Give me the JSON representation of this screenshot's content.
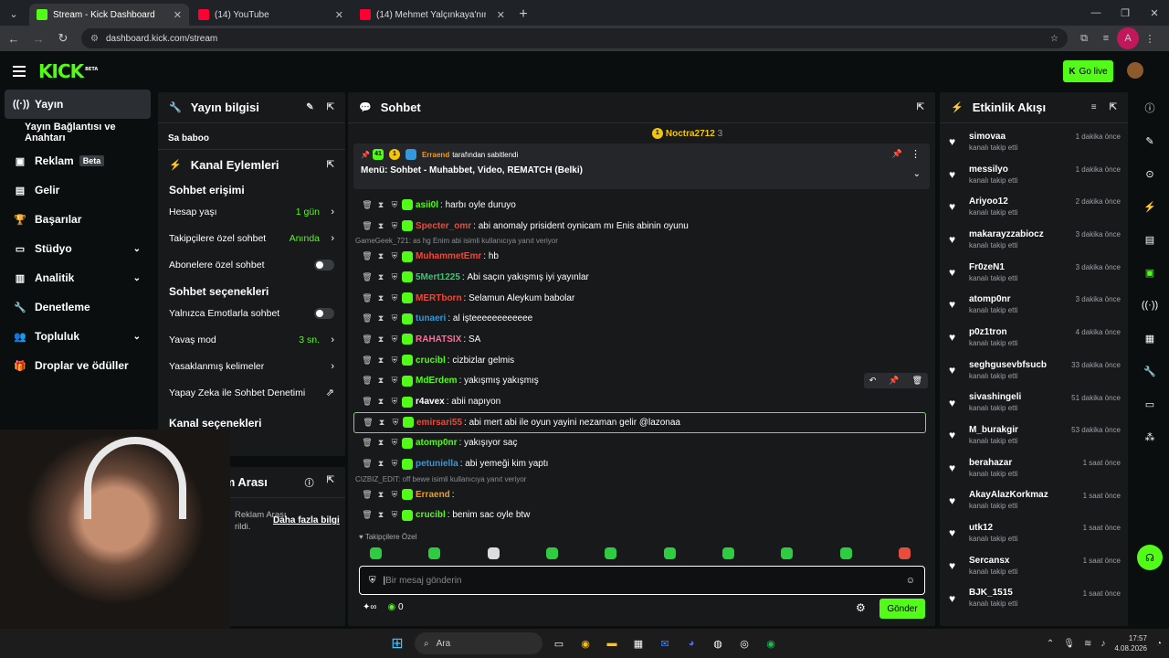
{
  "browser": {
    "tabs": [
      {
        "title": "Stream - Kick Dashboard",
        "fav_color": "#53fc18",
        "active": true
      },
      {
        "title": "(14) YouTube",
        "fav_color": "#ff0033",
        "active": false
      },
      {
        "title": "(14) Mehmet Yalçınkaya'nın Mu",
        "fav_color": "#ff0033",
        "active": false
      }
    ],
    "url": "dashboard.kick.com/stream",
    "profile_initial": "A"
  },
  "header": {
    "logo": "KICK",
    "logo_sup": "BETA",
    "go_live": "Go live"
  },
  "sidebar": {
    "items": [
      {
        "label": "Yayın",
        "icon": "broadcast-icon"
      },
      {
        "label": "Yayın Bağlantısı ve Anahtarı",
        "icon": ""
      },
      {
        "label": "Reklam",
        "icon": "ad-icon",
        "badge": "Beta"
      },
      {
        "label": "Gelir",
        "icon": "chart-icon"
      },
      {
        "label": "Başarılar",
        "icon": "trophy-icon"
      },
      {
        "label": "Stüdyo",
        "icon": "studio-icon"
      },
      {
        "label": "Analitik",
        "icon": "analytics-icon"
      },
      {
        "label": "Denetleme",
        "icon": "wrench-icon"
      },
      {
        "label": "Topluluk",
        "icon": "community-icon"
      },
      {
        "label": "Droplar ve ödüller",
        "icon": "gift-icon"
      }
    ]
  },
  "stream_info": {
    "title": "Yayın bilgisi",
    "stream_title": "Sa baboo"
  },
  "channel_actions": {
    "title": "Kanal Eylemleri",
    "chat_access": "Sohbet erişimi",
    "account_age": "Hesap yaşı",
    "account_age_val": "1 gün",
    "followers_only": "Takipçilere özel sohbet",
    "followers_only_val": "Anında",
    "subs_only": "Abonelere özel sohbet",
    "chat_options": "Sohbet seçenekleri",
    "emote_only": "Yalnızca Emotlarla sohbet",
    "slow_mode": "Yavaş mod",
    "slow_mode_val": "3 sn.",
    "banned_words": "Yasaklanmış kelimeler",
    "ai_moderation": "Yapay Zeka ile Sohbet Denetimi",
    "channel_options": "Kanal seçenekleri"
  },
  "ad_break": {
    "title": "Reklam Arası",
    "desc1": "Reklam Arası",
    "desc2": "rildi.",
    "more": "Daha fazla bilgi"
  },
  "chat": {
    "title": "Sohbet",
    "top_user": "Noctra2712",
    "top_count": "3",
    "pinned_by": "Erraend",
    "pinned_suffix": "tarafından sabitlendi",
    "pinned_msg": "Menü: Sohbet - Muhabbet, Video, REMATCH (Belki)",
    "messages": [
      {
        "user": "asii0l",
        "color": "#53fc18",
        "text": "harbı oyle duruyo"
      },
      {
        "user": "Specter_omr",
        "color": "#e74c3c",
        "text": "abi anomaly prisident oynicam mı Enis abinin oyunu"
      },
      {
        "reply": "GameGeek_721: as hg Enim abi isimli kullanıcıya yanıt veriyor"
      },
      {
        "user": "MuhammetEmr",
        "color": "#e74c3c",
        "text": "hb"
      },
      {
        "user": "5Mert1225",
        "color": "#2ecc71",
        "text": "Abi saçın yakışmış iyi yayınlar"
      },
      {
        "user": "MERTborn",
        "color": "#e74c3c",
        "text": "Selamun Aleykum babolar"
      },
      {
        "user": "tunaeri",
        "color": "#3498db",
        "text": "al işteeeeeeeeeeee"
      },
      {
        "user": "RAHATSIX",
        "color": "#ff6b9a",
        "text": "SA"
      },
      {
        "user": "crucibl",
        "color": "#53fc18",
        "text": "cizbizlar gelmis"
      },
      {
        "user": "MdErdem",
        "color": "#53fc18",
        "text": "yakışmış yakışmış"
      },
      {
        "user": "r4avex",
        "color": "#ffffff",
        "text": "abii napıyon"
      },
      {
        "user": "emirsari55",
        "color": "#e74c3c",
        "text": "abi mert abi ile oyun yayini nezaman gelir @lazonaa"
      },
      {
        "user": "atomp0nr",
        "color": "#53fc18",
        "text": "yakışıyor saç"
      },
      {
        "user": "petuniella",
        "color": "#3498db",
        "text": "abi yemeği kim yaptı"
      },
      {
        "reply": "CIZBIZ_EDIT: off bewe isimli kullanıcıya yanıt veriyor"
      },
      {
        "user": "Erraend",
        "color": "#f39c12",
        "text": ""
      },
      {
        "user": "crucibl",
        "color": "#53fc18",
        "text": "benim sac oyle btw"
      }
    ],
    "followers_label": "Takipçilere Özel",
    "input_placeholder": "Bir mesaj gönderin",
    "points": "0",
    "send": "Gönder"
  },
  "activity": {
    "title": "Etkinlik Akışı",
    "events": [
      {
        "user": "simovaa",
        "action": "kanalı takip etti",
        "time": "1 dakika önce"
      },
      {
        "user": "messilyo",
        "action": "kanalı takip etti",
        "time": "1 dakika önce"
      },
      {
        "user": "Ariyoo12",
        "action": "kanalı takip etti",
        "time": "2 dakika önce"
      },
      {
        "user": "makarayzzabiocz",
        "action": "kanalı takip etti",
        "time": "3 dakika önce"
      },
      {
        "user": "Fr0zeN1",
        "action": "kanalı takip etti",
        "time": "3 dakika önce"
      },
      {
        "user": "atomp0nr",
        "action": "kanalı takip etti",
        "time": "3 dakika önce"
      },
      {
        "user": "p0z1tron",
        "action": "kanalı takip etti",
        "time": "4 dakika önce"
      },
      {
        "user": "seghgusevbfsucb",
        "action": "kanalı takip etti",
        "time": "33 dakika önce"
      },
      {
        "user": "sivashingeli",
        "action": "kanalı takip etti",
        "time": "51 dakika önce"
      },
      {
        "user": "M_burakgir",
        "action": "kanalı takip etti",
        "time": "53 dakika önce"
      },
      {
        "user": "berahazar",
        "action": "kanalı takip etti",
        "time": "1 saat önce"
      },
      {
        "user": "AkayAlazKorkmaz",
        "action": "kanalı takip etti",
        "time": "1 saat önce"
      },
      {
        "user": "utk12",
        "action": "kanalı takip etti",
        "time": "1 saat önce"
      },
      {
        "user": "Sercansx",
        "action": "kanalı takip etti",
        "time": "1 saat önce"
      },
      {
        "user": "BJK_1515",
        "action": "kanalı takip etti",
        "time": "1 saat önce"
      }
    ]
  },
  "taskbar": {
    "search": "Ara",
    "time": "17:57",
    "date": "4.08.2026"
  }
}
